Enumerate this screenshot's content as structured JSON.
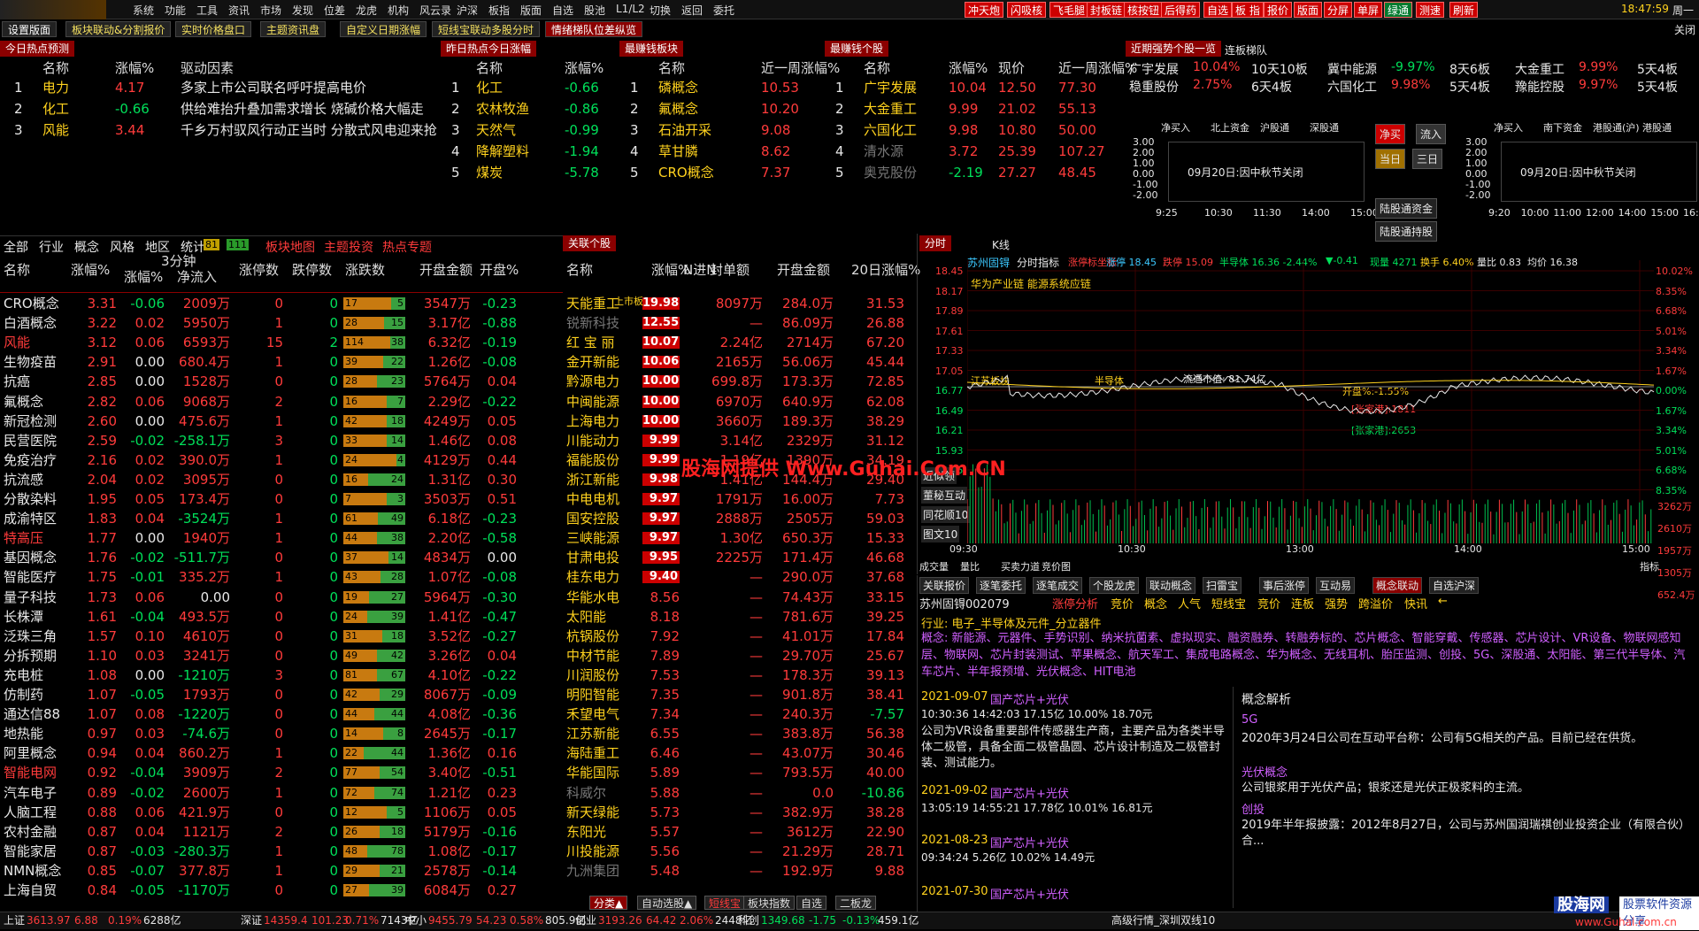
{
  "menu": {
    "items": [
      "系统",
      "功能",
      "工具",
      "资讯",
      "市场",
      "发现",
      "位差",
      "龙虎",
      "机构",
      "风云录",
      "沪深",
      "板指",
      "版面",
      "自选",
      "股池",
      "L1/L2",
      "切换",
      "返回",
      "委托"
    ],
    "quick": [
      "冲天炮",
      "闪吸核",
      "飞毛腿",
      "封板链",
      "核按钮",
      "后得药",
      "自选",
      "板 指",
      "报价",
      "版面",
      "分屏",
      "单屏",
      "绿通",
      "测速",
      "刷新"
    ],
    "time": "18:47:59",
    "weekday": "周一"
  },
  "tabs": [
    "设置版面",
    "板块联动&分割报价",
    "实时价格盘口",
    "主题资讯盘",
    "自定义日期涨幅",
    "短线宝联动多股分时",
    "情绪梯队位差纵览"
  ],
  "close": "关闭",
  "hot_today": {
    "title": "今日热点预测",
    "headers": [
      "名称",
      "涨幅%",
      "驱动因素"
    ],
    "rows": [
      [
        "1",
        "电力",
        "4.17",
        "多家上市公司联名呼吁提高电价"
      ],
      [
        "2",
        "化工",
        "-0.66",
        "供给难抬升叠加需求增长 烧碱价格大幅走"
      ],
      [
        "3",
        "风能",
        "3.44",
        "千乡万村驭风行动正当时 分散式风电迎来抢"
      ]
    ]
  },
  "hot_yest": {
    "title": "昨日热点今日涨幅",
    "headers": [
      "名称",
      "涨幅%"
    ],
    "rows": [
      [
        "1",
        "化工",
        "-0.66"
      ],
      [
        "2",
        "农林牧渔",
        "-0.86"
      ],
      [
        "3",
        "天然气",
        "-0.99"
      ],
      [
        "4",
        "降解塑料",
        "-1.94"
      ],
      [
        "5",
        "煤炭",
        "-5.78"
      ]
    ]
  },
  "earn_sector": {
    "title": "最赚钱板块",
    "headers": [
      "名称",
      "近一周涨幅%"
    ],
    "rows": [
      [
        "1",
        "磷概念",
        "10.53"
      ],
      [
        "2",
        "氟概念",
        "10.20"
      ],
      [
        "3",
        "石油开采",
        "9.08"
      ],
      [
        "4",
        "草甘膦",
        "8.62"
      ],
      [
        "5",
        "CRO概念",
        "7.37"
      ]
    ]
  },
  "earn_stock": {
    "title": "最赚钱个股",
    "headers": [
      "名称",
      "涨幅%",
      "现价",
      "近一周涨幅%"
    ],
    "rows": [
      [
        "1",
        "广宇发展",
        "10.04",
        "12.50",
        "77.30"
      ],
      [
        "2",
        "大金重工",
        "9.99",
        "21.02",
        "55.13"
      ],
      [
        "3",
        "六国化工",
        "9.98",
        "10.80",
        "50.00"
      ],
      [
        "4",
        "清水源",
        "3.72",
        "25.39",
        "107.27"
      ],
      [
        "5",
        "奥克股份",
        "-2.19",
        "27.27",
        "48.45"
      ]
    ]
  },
  "strong": {
    "tab1": "近期强势个股一览",
    "tab2": "连板梯队",
    "rows": [
      [
        "广宇发展",
        "10.04%",
        "10天10板",
        "冀中能源",
        "-9.97%",
        "8天6板",
        "大金重工",
        "9.99%",
        "5天4板"
      ],
      [
        "稳重股份",
        "2.75%",
        "6天4板",
        "六国化工",
        "9.98%",
        "5天4板",
        "豫能控股",
        "9.97%",
        "5天4板"
      ]
    ]
  },
  "fund": {
    "legend1": [
      "净买入",
      "北上资金",
      "沪股通",
      "深股通"
    ],
    "legend2": [
      "净买入",
      "南下资金",
      "港股通(沪)",
      "港股通"
    ],
    "y": [
      "3.00",
      "2.00",
      "1.00",
      "0.00",
      "-1.00",
      "-2.00"
    ],
    "x": [
      "9:25",
      "10:30",
      "11:30",
      "14:00",
      "15:00"
    ],
    "x2": [
      "9:20",
      "10:00",
      "11:00",
      "12:00",
      "14:00",
      "15:00",
      "16:10"
    ],
    "closed": "09月20日:因中秋节关闭",
    "b1": "净买",
    "b2": "流入",
    "b3": "当日",
    "b4": "三日",
    "b5": "陆股通资金",
    "b6": "陆股通持股"
  },
  "lefttabs": [
    "全部",
    "行业",
    "概念",
    "风格",
    "地区",
    "统计"
  ],
  "lt_badges": [
    "81",
    "111"
  ],
  "lt_extra": [
    "板块地图",
    "主题投资",
    "热点专题"
  ],
  "sector": {
    "headers": [
      "名称",
      "涨幅%",
      "3分钟涨幅%",
      "净流入",
      "涨停数",
      "跌停数",
      "涨跌数",
      "开盘金额",
      "开盘%"
    ],
    "hdr_top": "3分钟",
    "rows": [
      [
        "CRO概念",
        "3.31",
        "-0.06",
        "2009万",
        "0",
        "0",
        "17",
        "5",
        "3547万",
        "-0.23"
      ],
      [
        "白酒概念",
        "3.22",
        "0.02",
        "5950万",
        "1",
        "0",
        "28",
        "15",
        "3.17亿",
        "-0.88"
      ],
      [
        "风能",
        "3.12",
        "0.06",
        "6593万",
        "15",
        "2",
        "114",
        "38",
        "6.32亿",
        "-0.19"
      ],
      [
        "生物疫苗",
        "2.91",
        "0.00",
        "680.4万",
        "1",
        "0",
        "39",
        "22",
        "1.26亿",
        "-0.08"
      ],
      [
        "抗癌",
        "2.85",
        "0.00",
        "1528万",
        "0",
        "0",
        "28",
        "23",
        "5764万",
        "0.04"
      ],
      [
        "氟概念",
        "2.82",
        "0.06",
        "9068万",
        "2",
        "0",
        "16",
        "7",
        "2.29亿",
        "-0.22"
      ],
      [
        "新冠检测",
        "2.60",
        "0.00",
        "475.6万",
        "1",
        "0",
        "42",
        "18",
        "4249万",
        "0.05"
      ],
      [
        "民营医院",
        "2.59",
        "-0.02",
        "-258.1万",
        "3",
        "0",
        "33",
        "14",
        "1.46亿",
        "0.08"
      ],
      [
        "免疫治疗",
        "2.16",
        "0.02",
        "390.0万",
        "1",
        "0",
        "24",
        "4",
        "4129万",
        "0.44"
      ],
      [
        "抗流感",
        "2.04",
        "0.02",
        "3095万",
        "0",
        "0",
        "16",
        "24",
        "1.31亿",
        "0.30"
      ],
      [
        "分散染料",
        "1.95",
        "0.05",
        "173.4万",
        "0",
        "0",
        "7",
        "3",
        "3503万",
        "0.51"
      ],
      [
        "成渝特区",
        "1.83",
        "0.04",
        "-3524万",
        "1",
        "0",
        "61",
        "49",
        "6.18亿",
        "-0.23"
      ],
      [
        "特高压",
        "1.77",
        "0.00",
        "1940万",
        "1",
        "0",
        "44",
        "38",
        "2.20亿",
        "-0.58"
      ],
      [
        "基因概念",
        "1.76",
        "-0.02",
        "-511.7万",
        "0",
        "0",
        "37",
        "14",
        "4834万",
        "0.00"
      ],
      [
        "智能医疗",
        "1.75",
        "-0.01",
        "335.2万",
        "1",
        "0",
        "43",
        "28",
        "1.07亿",
        "-0.08"
      ],
      [
        "量子科技",
        "1.73",
        "0.06",
        "0.00",
        "0",
        "0",
        "19",
        "27",
        "5964万",
        "-0.30"
      ],
      [
        "长株潭",
        "1.61",
        "-0.04",
        "493.5万",
        "0",
        "0",
        "24",
        "39",
        "1.41亿",
        "-0.47"
      ],
      [
        "泛珠三角",
        "1.57",
        "0.10",
        "4610万",
        "0",
        "0",
        "31",
        "18",
        "3.52亿",
        "-0.27"
      ],
      [
        "分拆预期",
        "1.10",
        "0.03",
        "3241万",
        "0",
        "0",
        "49",
        "42",
        "3.26亿",
        "0.04"
      ],
      [
        "充电桩",
        "1.08",
        "0.00",
        "-1210万",
        "3",
        "0",
        "81",
        "67",
        "4.10亿",
        "-0.22"
      ],
      [
        "仿制药",
        "1.07",
        "-0.05",
        "1793万",
        "0",
        "0",
        "42",
        "29",
        "8067万",
        "-0.09"
      ],
      [
        "通达信88",
        "1.07",
        "0.08",
        "-1220万",
        "0",
        "0",
        "44",
        "44",
        "4.08亿",
        "-0.36"
      ],
      [
        "地热能",
        "0.97",
        "0.03",
        "-74.6万",
        "0",
        "0",
        "14",
        "8",
        "2645万",
        "-0.17"
      ],
      [
        "阿里概念",
        "0.94",
        "0.04",
        "860.2万",
        "1",
        "0",
        "22",
        "44",
        "1.36亿",
        "0.16"
      ],
      [
        "智能电网",
        "0.92",
        "-0.04",
        "3909万",
        "2",
        "0",
        "77",
        "54",
        "3.40亿",
        "-0.51"
      ],
      [
        "汽车电子",
        "0.89",
        "-0.02",
        "2600万",
        "1",
        "0",
        "72",
        "74",
        "1.21亿",
        "0.23"
      ],
      [
        "人脑工程",
        "0.88",
        "0.06",
        "421.9万",
        "0",
        "0",
        "12",
        "5",
        "1106万",
        "0.05"
      ],
      [
        "农村金融",
        "0.87",
        "0.04",
        "1121万",
        "2",
        "0",
        "26",
        "18",
        "5179万",
        "-0.16"
      ],
      [
        "智能家居",
        "0.87",
        "-0.03",
        "-280.3万",
        "1",
        "0",
        "48",
        "78",
        "1.08亿",
        "-0.17"
      ],
      [
        "NMN概念",
        "0.85",
        "-0.07",
        "377.8万",
        "1",
        "0",
        "29",
        "21",
        "2578万",
        "-0.14"
      ],
      [
        "上海自贸",
        "0.84",
        "-0.05",
        "-1170万",
        "0",
        "0",
        "27",
        "39",
        "6084万",
        "0.27"
      ]
    ]
  },
  "stocks": {
    "title": "关联个股",
    "headers": [
      "名称",
      "涨幅%",
      "N进N",
      "封单额",
      "开盘金额",
      "20日涨幅%"
    ],
    "tag": "上市板",
    "rows": [
      [
        "天能重工",
        "19.98",
        "",
        "8097万",
        "284.0万",
        "31.53"
      ],
      [
        "锐新科技",
        "12.55",
        "",
        "—",
        "86.09万",
        "26.88"
      ],
      [
        "红 宝 丽",
        "10.07",
        "",
        "2.24亿",
        "2714万",
        "67.20"
      ],
      [
        "金开新能",
        "10.06",
        "",
        "2165万",
        "56.06万",
        "45.44"
      ],
      [
        "黔源电力",
        "10.00",
        "",
        "699.8万",
        "173.3万",
        "72.85"
      ],
      [
        "中闽能源",
        "10.00",
        "",
        "6970万",
        "640.9万",
        "62.08"
      ],
      [
        "上海电力",
        "10.00",
        "",
        "3660万",
        "189.3万",
        "38.29"
      ],
      [
        "川能动力",
        "9.99",
        "",
        "3.14亿",
        "2329万",
        "31.12"
      ],
      [
        "福能股份",
        "9.99",
        "",
        "1.19亿",
        "1390万",
        "34.19"
      ],
      [
        "浙江新能",
        "9.98",
        "",
        "1.41亿",
        "144.4万",
        "29.40"
      ],
      [
        "中电电机",
        "9.97",
        "",
        "1791万",
        "16.00万",
        "7.73"
      ],
      [
        "国安控股",
        "9.97",
        "",
        "2888万",
        "2505万",
        "59.03"
      ],
      [
        "三峡能源",
        "9.97",
        "",
        "1.30亿",
        "650.3万",
        "15.33"
      ],
      [
        "甘肃电投",
        "9.95",
        "",
        "2225万",
        "171.4万",
        "46.68"
      ],
      [
        "桂东电力",
        "9.40",
        "",
        "—",
        "290.0万",
        "37.68"
      ],
      [
        "华能水电",
        "8.56",
        "",
        "—",
        "74.43万",
        "33.15"
      ],
      [
        "太阳能",
        "8.18",
        "",
        "—",
        "781.6万",
        "39.25"
      ],
      [
        "杭锅股份",
        "7.92",
        "",
        "—",
        "41.01万",
        "17.84"
      ],
      [
        "中材节能",
        "7.89",
        "",
        "—",
        "29.70万",
        "25.67"
      ],
      [
        "川润股份",
        "7.53",
        "",
        "—",
        "178.3万",
        "39.13"
      ],
      [
        "明阳智能",
        "7.35",
        "",
        "—",
        "901.8万",
        "38.41"
      ],
      [
        "禾望电气",
        "7.34",
        "",
        "—",
        "240.3万",
        "-7.57"
      ],
      [
        "江苏新能",
        "6.55",
        "",
        "—",
        "383.8万",
        "56.38"
      ],
      [
        "海陆重工",
        "6.46",
        "",
        "—",
        "43.07万",
        "30.46"
      ],
      [
        "华能国际",
        "5.89",
        "",
        "—",
        "793.5万",
        "40.00"
      ],
      [
        "科威尔",
        "5.88",
        "",
        "—",
        "0.0",
        "-10.86"
      ],
      [
        "新天绿能",
        "5.73",
        "",
        "—",
        "382.9万",
        "38.28"
      ],
      [
        "东阳光",
        "5.57",
        "",
        "—",
        "3612万",
        "22.90"
      ],
      [
        "川投能源",
        "5.56",
        "",
        "—",
        "21.29万",
        "28.71"
      ],
      [
        "九洲集团",
        "5.48",
        "",
        "—",
        "192.9万",
        "9.88"
      ]
    ]
  },
  "bottomtabs": [
    "分类▲",
    "自动选股▲",
    "短线宝",
    "板块指数",
    "自选",
    "二板龙"
  ],
  "chart": {
    "tab1": "分时",
    "tab2": "K线",
    "title": "苏州固锝",
    "sub": "分时指标",
    "legend": [
      "涨停标坐标",
      "涨停 18.45",
      "跌停 15.09",
      "半导体 16.36 -2.44%",
      "▼-0.41",
      "现量 4271",
      "换手 6.40%",
      "量比 0.83",
      "均价 16.38"
    ],
    "note": "华为产业链 能源系统应链",
    "labels": [
      "江苏板块",
      "半导体",
      "流通市值: 81.74亿",
      "开盘%:-1.55%",
      "[张家港]:1811",
      "[张家港]:2653"
    ],
    "yl": [
      "18.45",
      "18.17",
      "17.89",
      "17.61",
      "17.33",
      "17.05",
      "16.77",
      "16.49",
      "16.21",
      "15.93",
      "15.65",
      "15.37"
    ],
    "yr": [
      "10.02%",
      "8.35%",
      "6.68%",
      "5.01%",
      "3.34%",
      "1.67%",
      "0.00%",
      "1.67%",
      "3.34%",
      "5.01%",
      "6.68%",
      "8.35%"
    ],
    "vol": [
      "3262万",
      "2610万",
      "1957万",
      "1305万",
      "652.4万"
    ],
    "side": [
      "近似领",
      "董秘互动",
      "同花顺10",
      "图文10"
    ],
    "xt": [
      "09:30",
      "10:30",
      "13:00",
      "14:00",
      "15:00"
    ],
    "ind": [
      "成交量",
      "量比",
      "买卖力道",
      "竞价图"
    ],
    "ind_r": "指标"
  },
  "info": {
    "tabs": [
      "关联报价",
      "逐笔委托",
      "逐笔成交",
      "个股龙虎",
      "联动概念",
      "扫雷宝",
      "事后涨停",
      "互动易",
      "概念联动",
      "自选沪深"
    ],
    "tabs2": [
      "苏州固锝002079",
      "涨停分析",
      "竞价",
      "概念",
      "人气",
      "短线宝",
      "竞价",
      "连板",
      "强势",
      "跨溢价",
      "快讯",
      "←"
    ],
    "industry": "行业: 电子_半导体及元件_分立器件",
    "concept": "概念: 新能源、元器件、手势识别、纳米抗菌素、虚拟现实、融资融券、转融券标的、芯片概念、智能穿戴、传感器、芯片设计、VR设备、物联网感知层、物联网、芯片封装测试、苹果概念、航天军工、集成电路概念、华为概念、无线耳机、胎压监测、创投、5G、深股通、太阳能、第三代半导体、汽车芯片、半年报预增、光伏概念、HIT电池",
    "news": [
      {
        "date": "2021-09-07",
        "tag": "国产芯片+光伏",
        "line": "10:30:36 14:42:03 17.15亿 10.00% 18.70元",
        "text": "公司为VR设备重要部件传感器生产商，主要产品为各类半导体二极管，具备全面二极管晶圆、芯片设计制造及二极管封装、测试能力。"
      },
      {
        "date": "2021-09-02",
        "tag": "国产芯片+光伏",
        "line": "13:05:19 14:55:21 17.78亿 10.01% 16.81元",
        "text": ""
      },
      {
        "date": "2021-08-23",
        "tag": "国产芯片+光伏",
        "line": "09:34:24 5.26亿 10.02% 14.49元",
        "text": ""
      },
      {
        "date": "2021-07-30",
        "tag": "国产芯片+光伏",
        "line": "",
        "text": ""
      }
    ],
    "analysis_title": "概念解析",
    "analysis": [
      {
        "k": "5G",
        "v": "2020年3月24日公司在互动平台称：公司有5G相关的产品。目前已经在供货。"
      },
      {
        "k": "光伏概念",
        "v": "公司银浆用于光伏产品；银浆还是光伏正极浆料的主流。"
      },
      {
        "k": "创投",
        "v": "2019年半年报披露：2012年8月27日，公司与苏州国润瑞祺创业投资企业（有限合伙）合..."
      }
    ]
  },
  "watermark": "股海网提供 Www.Guhai.Com.CN",
  "status": {
    "items": [
      [
        "上证",
        "3613.97",
        "6.88",
        "0.19%",
        "6288亿"
      ],
      [
        "深证",
        "14359.4",
        "101.23",
        "0.71%",
        "7143亿"
      ],
      [
        "中小",
        "9455.79",
        "54.23",
        "0.58%",
        "805.9亿"
      ],
      [
        "创业",
        "3193.26",
        "64.42",
        "2.06%",
        "2448亿"
      ],
      [
        "科创",
        "1349.68",
        "-1.75",
        "-0.13%",
        "459.1亿"
      ]
    ],
    "right": "高级行情_深圳双线10",
    "brand": "股海网",
    "brand2": "股票软件资源分享",
    "brand3": "www.Guhai.com.cn"
  }
}
